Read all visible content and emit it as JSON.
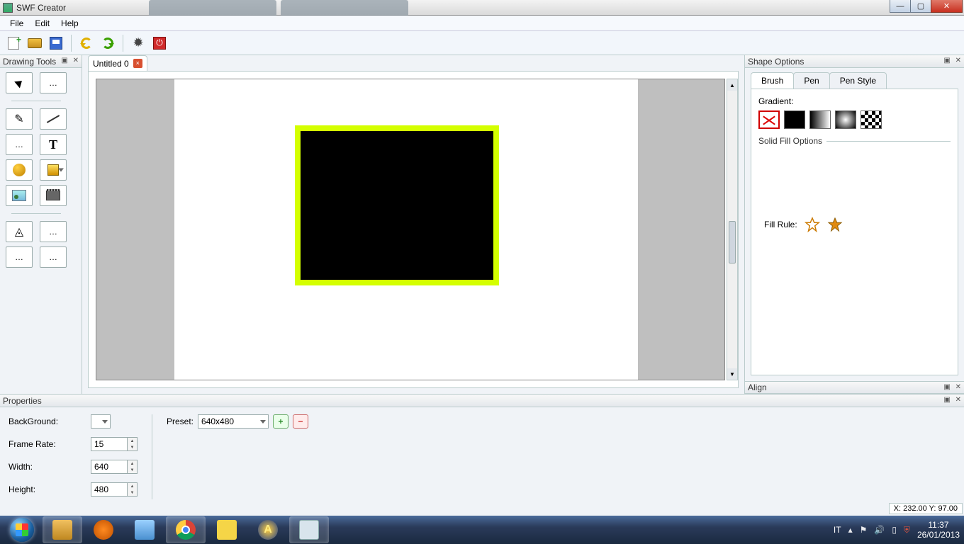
{
  "window": {
    "title": "SWF Creator",
    "min": "—",
    "max": "▢",
    "close": "✕"
  },
  "menu": {
    "file": "File",
    "edit": "Edit",
    "help": "Help"
  },
  "panels": {
    "drawing_tools": "Drawing Tools",
    "shape_options": "Shape Options",
    "align": "Align",
    "properties": "Properties",
    "ctrl_glyphs": "▣ ✕"
  },
  "shape_opts": {
    "tab_brush": "Brush",
    "tab_pen": "Pen",
    "tab_penstyle": "Pen Style",
    "gradient_label": "Gradient:",
    "solid_fill_label": "Solid Fill Options",
    "fill_rule_label": "Fill Rule:"
  },
  "document": {
    "tab_label": "Untitled 0"
  },
  "properties": {
    "background_label": "BackGround:",
    "framerate_label": "Frame Rate:",
    "framerate_value": "15",
    "width_label": "Width:",
    "width_value": "640",
    "height_label": "Height:",
    "height_value": "480",
    "preset_label": "Preset:",
    "preset_value": "640x480"
  },
  "status": {
    "coord": "X: 232.00 Y: 97.00"
  },
  "tray": {
    "lang": "IT",
    "time": "11:37",
    "date": "26/01/2013"
  }
}
